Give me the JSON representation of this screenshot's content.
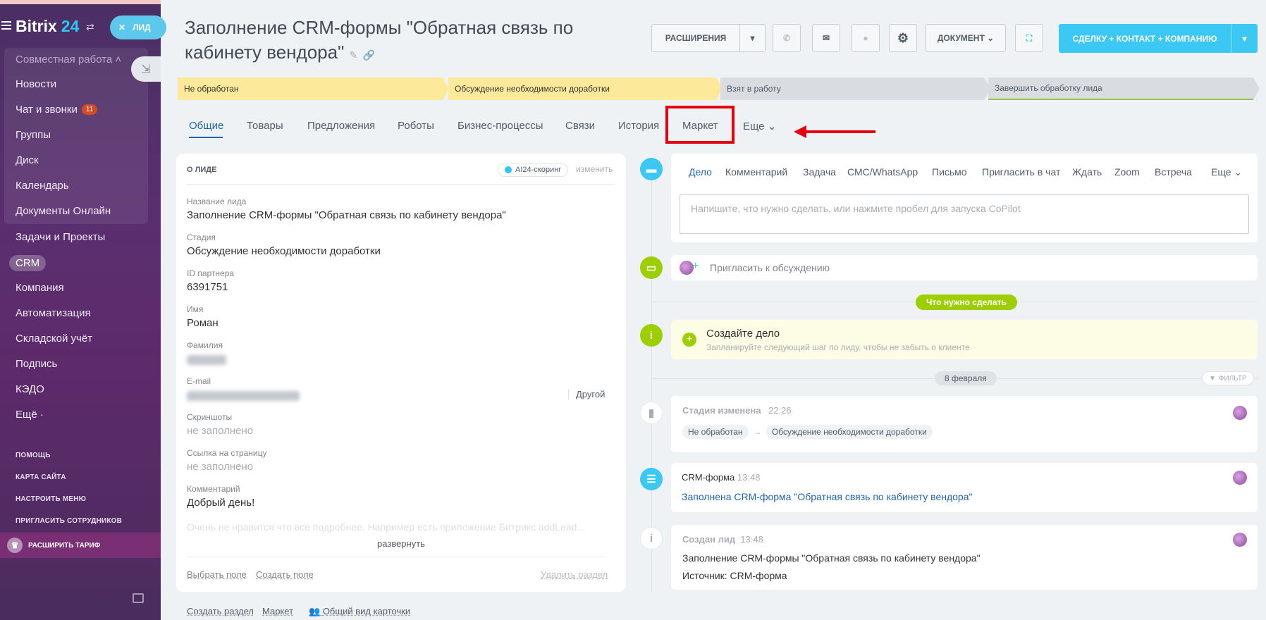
{
  "sidebar": {
    "brand": "Bitrix",
    "brand_num": "24",
    "lead_pill": "ЛИД",
    "group_title": "Совместная работа",
    "items": [
      {
        "label": "Новости"
      },
      {
        "label": "Чат и звонки",
        "badge": "11"
      },
      {
        "label": "Группы"
      },
      {
        "label": "Диск"
      },
      {
        "label": "Календарь"
      },
      {
        "label": "Документы Онлайн"
      },
      {
        "label": "Задачи и Проекты"
      },
      {
        "label": "CRM"
      },
      {
        "label": "Компания"
      },
      {
        "label": "Автоматизация"
      },
      {
        "label": "Складской учёт"
      },
      {
        "label": "Подпись"
      },
      {
        "label": "КЭДО"
      },
      {
        "label": "Ещё ·"
      }
    ],
    "links": [
      "ПОМОЩЬ",
      "КАРТА САЙТА",
      "НАСТРОИТЬ МЕНЮ",
      "ПРИГЛАСИТЬ СОТРУДНИКОВ"
    ],
    "upgrade": "РАСШИРИТЬ ТАРИФ"
  },
  "header": {
    "title": "Заполнение CRM-формы \"Обратная связь по кабинету вендора\"",
    "extensions": "РАСШИРЕНИЯ",
    "document": "ДОКУМЕНТ",
    "primary": "СДЕЛКУ + КОНТАКТ + КОМПАНИЮ"
  },
  "stages": [
    "Не обработан",
    "Обсуждение необходимости доработки",
    "Взят в работу",
    "Завершить обработку лида"
  ],
  "tabs": [
    "Общие",
    "Товары",
    "Предложения",
    "Роботы",
    "Бизнес-процессы",
    "Связи",
    "История",
    "Маркет",
    "Еще"
  ],
  "card": {
    "heading": "О ЛИДЕ",
    "ai": "AI24-скоринг",
    "change": "изменить",
    "fields": [
      {
        "label": "Название лида",
        "value": "Заполнение CRM-формы \"Обратная связь по кабинету вендора\""
      },
      {
        "label": "Стадия",
        "value": "Обсуждение необходимости доработки"
      },
      {
        "label": "ID партнера",
        "value": "6391751"
      },
      {
        "label": "Имя",
        "value": "Роман"
      },
      {
        "label": "Фамилия",
        "value": ""
      },
      {
        "label": "E-mail",
        "value": ""
      },
      {
        "label": "Скриншоты",
        "value": "не заполнено"
      },
      {
        "label": "Ссылка на страницу",
        "value": "не заполнено"
      },
      {
        "label": "Комментарий",
        "value": "Добрый день!"
      }
    ],
    "email_type": "Другой",
    "faded": "Очень не нравится что все подробнее. Например есть приложение Битрикс addLead...",
    "expand": "развернуть",
    "choose_field": "Выбрать поле",
    "create_field": "Создать поле",
    "delete_section": "Удалить раздел"
  },
  "bottom": {
    "create_section": "Создать раздел",
    "market": "Маркет",
    "common_view": "Общий вид карточки"
  },
  "editor": {
    "tabs": [
      "Дело",
      "Комментарий",
      "Задача",
      "СМС/WhatsApp",
      "Письмо",
      "Пригласить в чат",
      "Ждать",
      "Zoom",
      "Встреча",
      "Еще"
    ],
    "placeholder": "Напишите, что нужно сделать, или нажмите пробел для запуска CoPilot"
  },
  "timeline": {
    "invite": "Пригласить к обсуждению",
    "todo_pill": "Что нужно сделать",
    "create_title": "Создайте дело",
    "create_sub": "Запланируйте следующий шаг по лиду, чтобы не забыть о клиенте",
    "date": "8 февраля",
    "filter": "ФИЛЬТР",
    "stage_title": "Стадия изменена",
    "stage_time": "22:26",
    "stage_from": "Не обработан",
    "stage_to": "Обсуждение необходимости доработки",
    "form_title": "CRM-форма",
    "form_time": "13:48",
    "form_link": "Заполнена CRM-форма \"Обратная связь по кабинету вендора\"",
    "created_title": "Создан лид",
    "created_time": "13:48",
    "created_line1": "Заполнение CRM-формы \"Обратная связь по кабинету вендора\"",
    "created_line2": "Источник: CRM-форма"
  }
}
